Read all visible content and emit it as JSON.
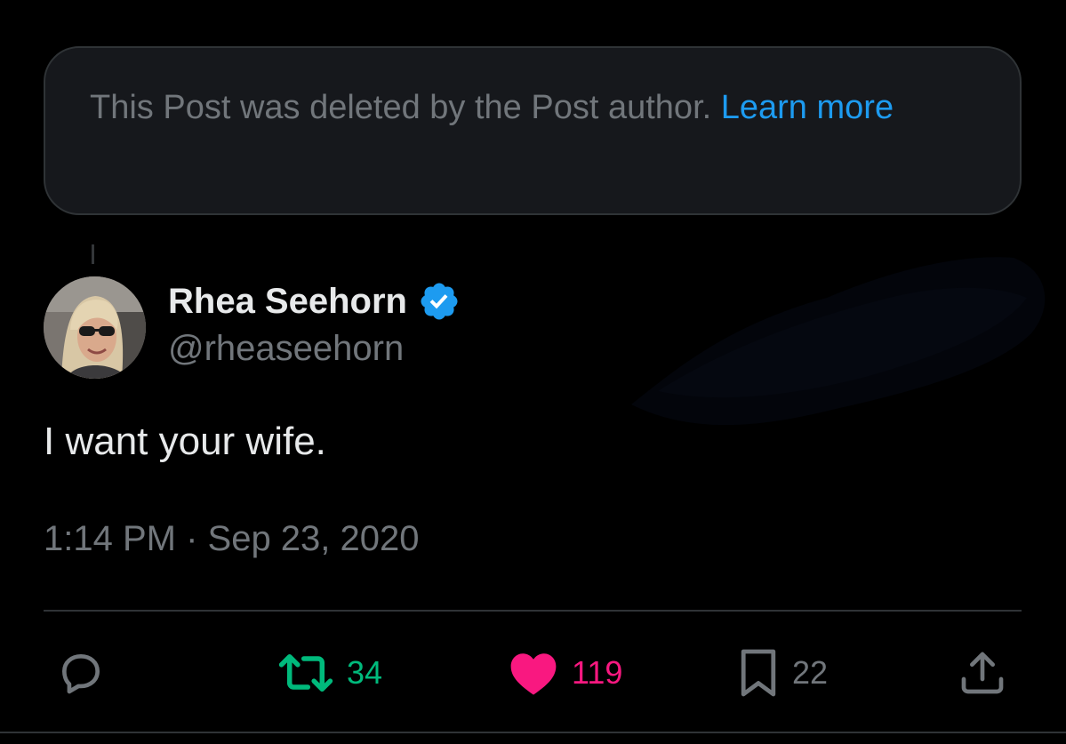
{
  "notice": {
    "text": "This Post was deleted by the Post author. ",
    "link": "Learn more"
  },
  "author": {
    "name": "Rhea Seehorn",
    "handle": "@rheaseehorn",
    "verified": true
  },
  "post": {
    "text": "I want your wife.",
    "timestamp": "1:14 PM · Sep 23, 2020"
  },
  "actions": {
    "reply": {
      "icon": "reply-icon",
      "count": ""
    },
    "repost": {
      "icon": "repost-icon",
      "count": "34",
      "color": "#00ba7c"
    },
    "like": {
      "icon": "heart-icon",
      "count": "119",
      "color": "#f91880"
    },
    "bookmark": {
      "icon": "bookmark-icon",
      "count": "22"
    },
    "share": {
      "icon": "share-icon"
    }
  },
  "colors": {
    "background": "#000000",
    "accent": "#1d9bf0",
    "muted": "#71767b",
    "verified": "#1d9bf0"
  }
}
